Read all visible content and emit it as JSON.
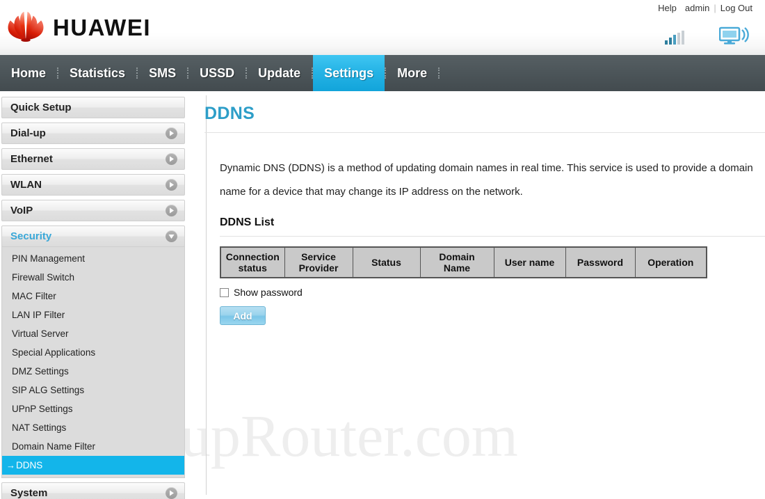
{
  "brand": {
    "name": "HUAWEI",
    "logo_color": "#d81e06"
  },
  "topbar": {
    "help": "Help",
    "user": "admin",
    "logout": "Log Out",
    "separator": "|",
    "signal_icon": "signal-bars-icon",
    "device_icon": "wifi-monitor-icon"
  },
  "nav": {
    "items": [
      {
        "label": "Home",
        "active": false
      },
      {
        "label": "Statistics",
        "active": false
      },
      {
        "label": "SMS",
        "active": false
      },
      {
        "label": "USSD",
        "active": false
      },
      {
        "label": "Update",
        "active": false
      },
      {
        "label": "Settings",
        "active": true
      },
      {
        "label": "More",
        "active": false
      }
    ],
    "active_color": "#13b5ea",
    "bar_color": "#4c5559"
  },
  "sidebar": {
    "groups": [
      {
        "label": "Quick Setup",
        "state": "none"
      },
      {
        "label": "Dial-up",
        "state": "collapsed"
      },
      {
        "label": "Ethernet",
        "state": "collapsed"
      },
      {
        "label": "WLAN",
        "state": "collapsed"
      },
      {
        "label": "VoIP",
        "state": "collapsed"
      },
      {
        "label": "Security",
        "state": "expanded"
      }
    ],
    "security_items": [
      {
        "label": "PIN Management",
        "selected": false
      },
      {
        "label": "Firewall Switch",
        "selected": false
      },
      {
        "label": "MAC Filter",
        "selected": false
      },
      {
        "label": "LAN IP Filter",
        "selected": false
      },
      {
        "label": "Virtual Server",
        "selected": false
      },
      {
        "label": "Special Applications",
        "selected": false
      },
      {
        "label": "DMZ Settings",
        "selected": false
      },
      {
        "label": "SIP ALG Settings",
        "selected": false
      },
      {
        "label": "UPnP Settings",
        "selected": false
      },
      {
        "label": "NAT Settings",
        "selected": false
      },
      {
        "label": "Domain Name Filter",
        "selected": false
      },
      {
        "label": "DDNS",
        "selected": true,
        "prefix": "→"
      }
    ],
    "system_group": {
      "label": "System",
      "state": "collapsed"
    },
    "selected_color": "#13b5ea"
  },
  "content": {
    "title": "DDNS",
    "title_color": "#2d9ec8",
    "description": "Dynamic DNS (DDNS) is a method of updating domain names in real time. This service is used to provide a domain name for a device that may change its IP address on the network.",
    "list_title": "DDNS List",
    "table": {
      "headers": [
        "Connection status",
        "Service Provider",
        "Status",
        "Domain Name",
        "User name",
        "Password",
        "Operation"
      ],
      "rows": []
    },
    "show_password_label": "Show password",
    "show_password_checked": false,
    "add_button": "Add"
  },
  "watermark": {
    "text": "SetupRouter.com"
  }
}
